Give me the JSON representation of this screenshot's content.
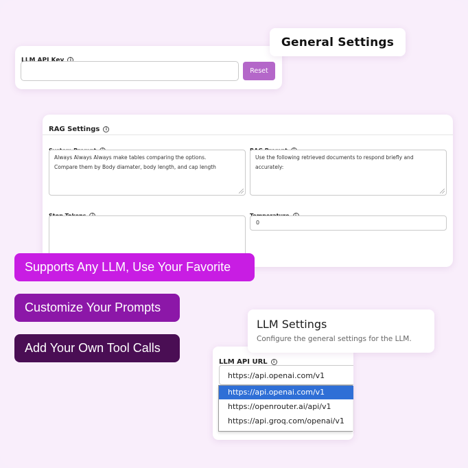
{
  "general_settings": {
    "title": "General Settings"
  },
  "llm_api_key": {
    "label": "LLM API Key",
    "value": "",
    "reset_label": "Reset"
  },
  "rag_settings": {
    "title": "RAG Settings",
    "system_prompt": {
      "label": "System Prompt",
      "line1": "Always Always Always make tables comparing the options.",
      "line2": "Compare them by Body diamater, body length, and cap length"
    },
    "rag_prompt": {
      "label": "RAG Prompt",
      "line1": "Use the following retrieved documents to respond briefly and",
      "line2": "accurately:"
    },
    "stop_tokens": {
      "label": "Stop Tokens",
      "value": ""
    },
    "temperature": {
      "label": "Temperature",
      "value": "0"
    }
  },
  "features": [
    {
      "label": "Supports Any LLM, Use Your Favorite",
      "color": "#c81de3"
    },
    {
      "label": "Customize Your Prompts",
      "color": "#8c17a8"
    },
    {
      "label": "Add Your Own Tool Calls",
      "color": "#4a0e54"
    }
  ],
  "llm_settings": {
    "title": "LLM Settings",
    "description": "Configure the general settings for the LLM."
  },
  "llm_api_url": {
    "label": "LLM API URL",
    "selected": "https://api.openai.com/v1",
    "options": [
      "https://api.openai.com/v1",
      "https://openrouter.ai/api/v1",
      "https://api.groq.com/openai/v1"
    ],
    "highlight_color": "#2f6fd6"
  },
  "icons": {
    "info": "info-icon"
  }
}
